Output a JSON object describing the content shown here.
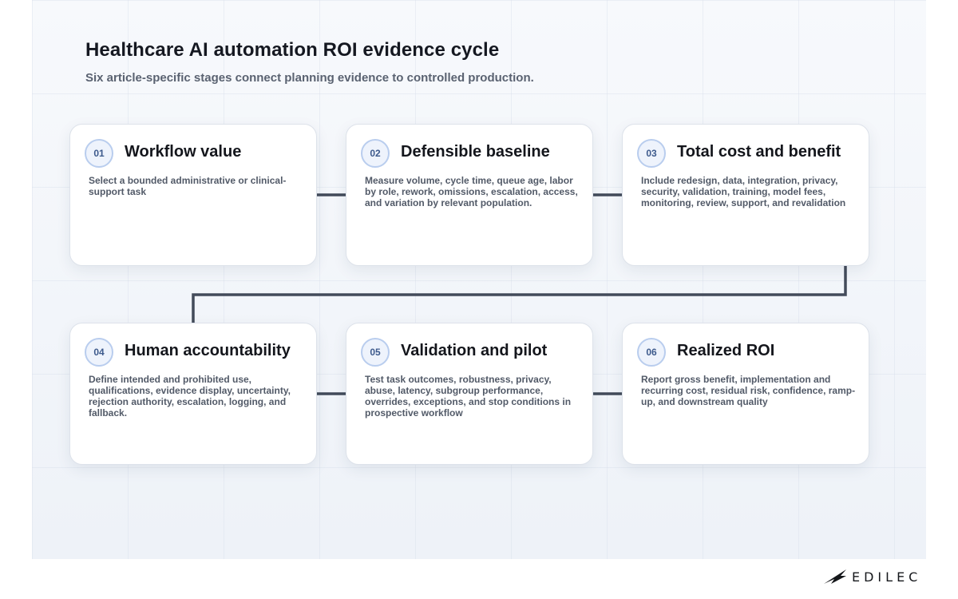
{
  "header": {
    "title": "Healthcare AI automation ROI evidence cycle",
    "subtitle": "Six article-specific stages connect planning evidence to controlled production."
  },
  "stages": [
    {
      "number": "01",
      "title": "Workflow value",
      "body": "Select a bounded administrative or clinical-support task"
    },
    {
      "number": "02",
      "title": "Defensible baseline",
      "body": "Measure volume, cycle time, queue age, labor by role, rework, omissions, escalation, access, and variation by relevant population."
    },
    {
      "number": "03",
      "title": "Total cost and benefit",
      "body": "Include redesign, data, integration, privacy, security, validation, training, model fees, monitoring, review, support, and revalidation"
    },
    {
      "number": "04",
      "title": "Human accountability",
      "body": "Define intended and prohibited use, qualifications, evidence display, uncertainty, rejection authority, escalation, logging, and fallback."
    },
    {
      "number": "05",
      "title": "Validation and pilot",
      "body": "Test task outcomes, robustness, privacy, abuse, latency, subgroup performance, overrides, exceptions, and stop conditions in prospective workflow"
    },
    {
      "number": "06",
      "title": "Realized ROI",
      "body": "Report gross benefit, implementation and recurring cost, residual risk, confidence, ramp-up, and downstream quality"
    }
  ],
  "brand": {
    "name": "EDILEC"
  },
  "colors": {
    "connector": "#434b5a",
    "badge_border": "#b9cdee",
    "badge_fill": "#eef3fc",
    "badge_text": "#3d5a8c"
  }
}
